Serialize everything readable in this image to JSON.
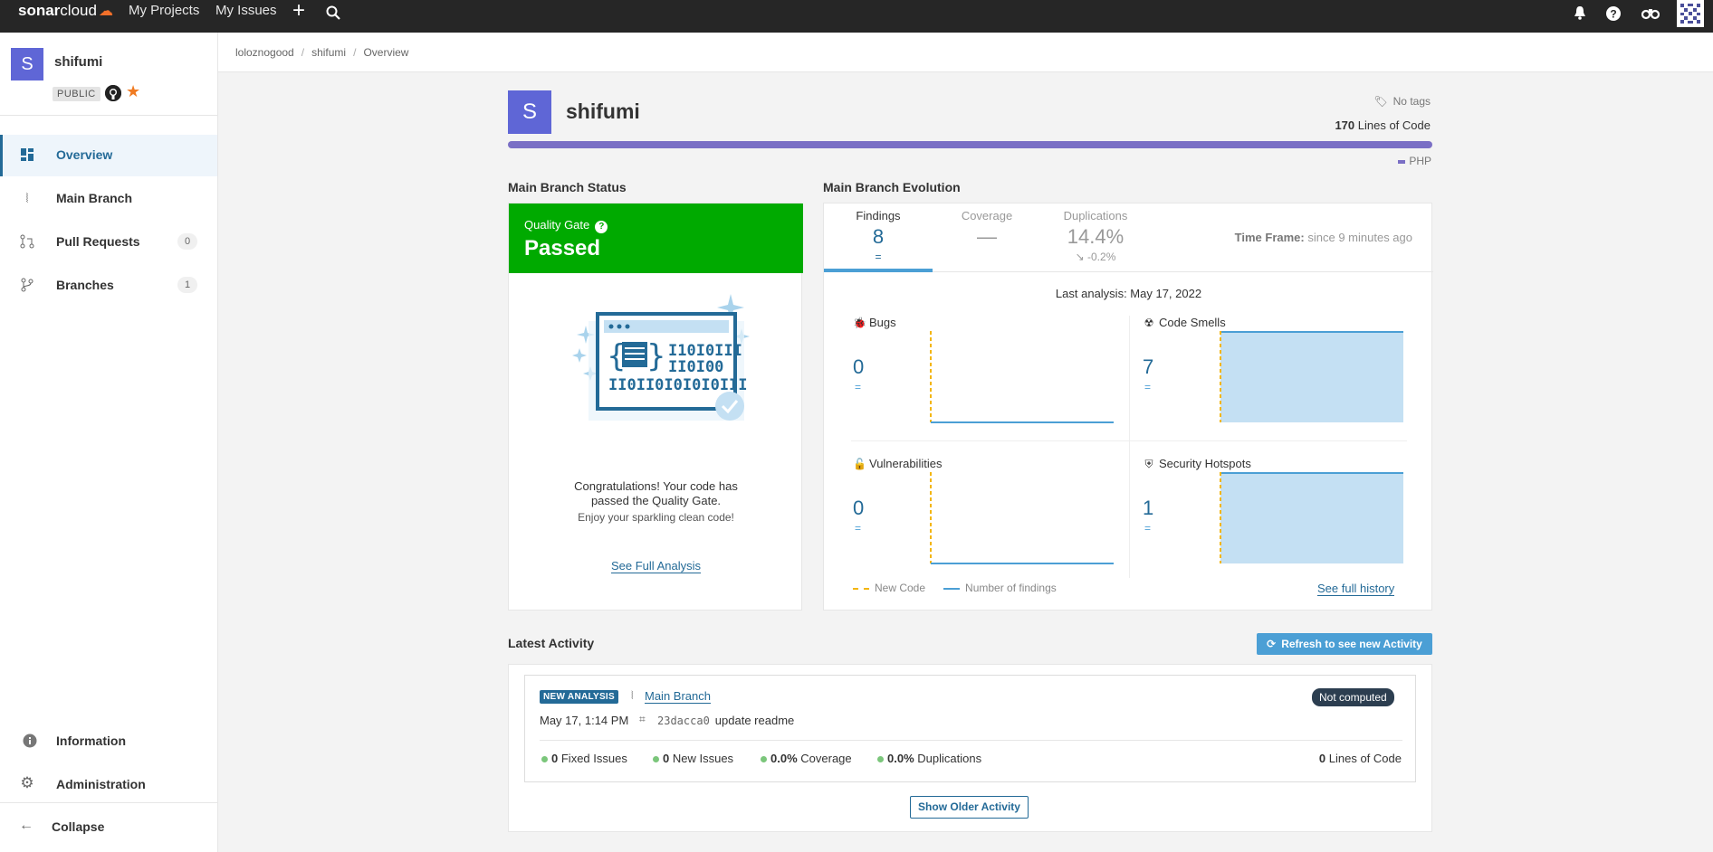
{
  "topnav": {
    "logo_prefix": "sonar",
    "logo_suffix": "cloud",
    "links": [
      "My Projects",
      "My Issues"
    ],
    "icons": [
      "plus-icon",
      "search-icon",
      "bell-icon",
      "help-icon",
      "binoculars-icon"
    ]
  },
  "sidebar": {
    "project_initial": "S",
    "project_name": "shifumi",
    "visibility": "PUBLIC",
    "items": [
      {
        "label": "Overview",
        "icon": "overview-icon"
      },
      {
        "label": "Main Branch",
        "icon": "branch-icon"
      },
      {
        "label": "Pull Requests",
        "icon": "pull-request-icon",
        "count": "0"
      },
      {
        "label": "Branches",
        "icon": "branches-icon",
        "count": "1"
      }
    ],
    "bottom_items": [
      {
        "label": "Information",
        "icon": "info-icon"
      },
      {
        "label": "Administration",
        "icon": "gear-icon"
      }
    ],
    "collapse_label": "Collapse"
  },
  "breadcrumb": [
    "loloznogood",
    "shifumi",
    "Overview"
  ],
  "project_header": {
    "initial": "S",
    "name": "shifumi",
    "tags": "No tags",
    "loc_value": "170",
    "loc_label": "Lines of Code",
    "language": "PHP"
  },
  "quality_gate": {
    "section_title": "Main Branch Status",
    "label": "Quality Gate",
    "status": "Passed",
    "message_line1": "Congratulations! Your code has",
    "message_line2": "passed the Quality Gate.",
    "sub_message": "Enjoy your sparkling clean code!",
    "link": "See Full Analysis",
    "color": "#00aa00"
  },
  "evolution": {
    "section_title": "Main Branch Evolution",
    "tabs": [
      {
        "title": "Findings",
        "value": "8",
        "sub": "="
      },
      {
        "title": "Coverage",
        "value": "—",
        "sub": ""
      },
      {
        "title": "Duplications",
        "value": "14.4%",
        "sub": "↘ -0.2%"
      }
    ],
    "timeframe_label": "Time Frame:",
    "timeframe_value": "since 9 minutes ago",
    "last_analysis": "Last analysis: May 17, 2022",
    "metrics": [
      {
        "title": "Bugs",
        "value": "0",
        "delta": "=",
        "icon": "bug-icon"
      },
      {
        "title": "Code Smells",
        "value": "7",
        "delta": "=",
        "icon": "code-smell-icon"
      },
      {
        "title": "Vulnerabilities",
        "value": "0",
        "delta": "=",
        "icon": "lock-icon"
      },
      {
        "title": "Security Hotspots",
        "value": "1",
        "delta": "=",
        "icon": "shield-icon"
      }
    ],
    "legend_new_code": "New Code",
    "legend_findings": "Number of findings",
    "full_history": "See full history"
  },
  "activity": {
    "section_title": "Latest Activity",
    "refresh_label": "Refresh to see new Activity",
    "badge": "NEW ANALYSIS",
    "branch": "Main Branch",
    "status": "Not computed",
    "date": "May 17, 1:14 PM",
    "commit_hash": "23dacca0",
    "commit_message": "update readme",
    "stats": [
      {
        "value": "0",
        "label": "Fixed Issues"
      },
      {
        "value": "0",
        "label": "New Issues"
      },
      {
        "value": "0.0%",
        "label": "Coverage"
      },
      {
        "value": "0.0%",
        "label": "Duplications"
      }
    ],
    "loc_value": "0",
    "loc_label": "Lines of Code",
    "older_label": "Show Older Activity"
  }
}
